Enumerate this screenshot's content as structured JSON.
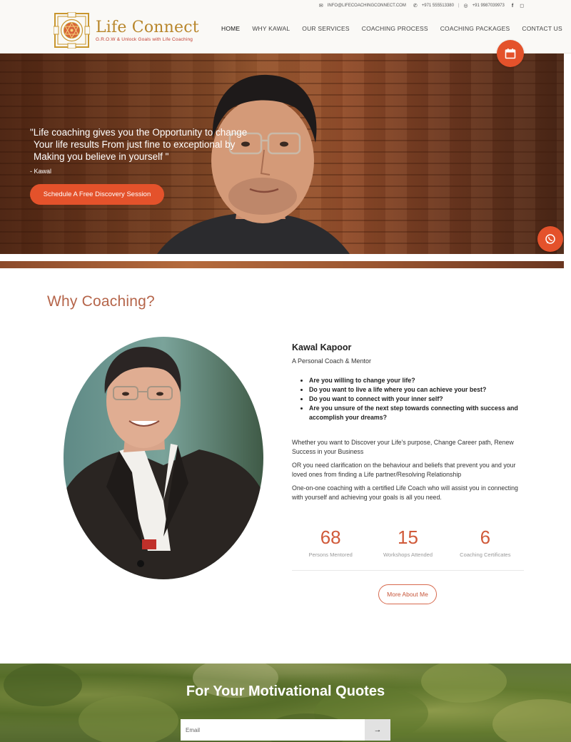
{
  "topbar": {
    "email": "INFO@LIFECOACHINGCONNECT.COM",
    "phone": "+971 555513380",
    "whatsapp": "+91 9987039973"
  },
  "brand": {
    "title": "Life Connect",
    "tagline": "G.R.O.W & Unlock Goals with Life Coaching",
    "logo_icon": "yantra-logo",
    "gold": "#b8862b",
    "accent": "#e4522b"
  },
  "nav": {
    "items": [
      {
        "label": "HOME"
      },
      {
        "label": "WHY KAWAL"
      },
      {
        "label": "OUR SERVICES"
      },
      {
        "label": "COACHING PROCESS"
      },
      {
        "label": "COACHING PACKAGES"
      },
      {
        "label": "CONTACT US"
      }
    ]
  },
  "hero": {
    "quote_lines": [
      "\"Life coaching gives you the Opportunity to change",
      "Your life results From just fine to exceptional by",
      "Making you believe in yourself \""
    ],
    "author": "- Kawal",
    "cta": "Schedule A Free Discovery Session"
  },
  "why": {
    "title": "Why Coaching?"
  },
  "bio": {
    "name": "Kawal Kapoor",
    "role": "A Personal Coach & Mentor",
    "questions": [
      "Are you willing to change your life?",
      "Do you want to live a life where you can achieve your best?",
      "Do you want to connect with your inner self?",
      "Are you unsure of the next step towards connecting with success and accomplish your dreams?"
    ],
    "paragraphs": [
      "Whether you want to Discover your Life's purpose, Change Career path, Renew Success in your Business",
      "OR you need clarification on the behaviour and beliefs that prevent you and your loved ones from finding a Life partner/Resolving Relationship",
      "One-on-one coaching with a certified Life Coach who will assist you in connecting with yourself and achieving your goals is all you need."
    ]
  },
  "stats": [
    {
      "value": "68",
      "label": "Persons Mentored"
    },
    {
      "value": "15",
      "label": "Workshops Attended"
    },
    {
      "value": "6",
      "label": "Coaching Certificates"
    }
  ],
  "more_button": "More About Me",
  "newsletter": {
    "title": "For Your Motivational Quotes",
    "placeholder": "Email",
    "submit_icon": "arrow-right-icon",
    "submit_glyph": "→"
  }
}
